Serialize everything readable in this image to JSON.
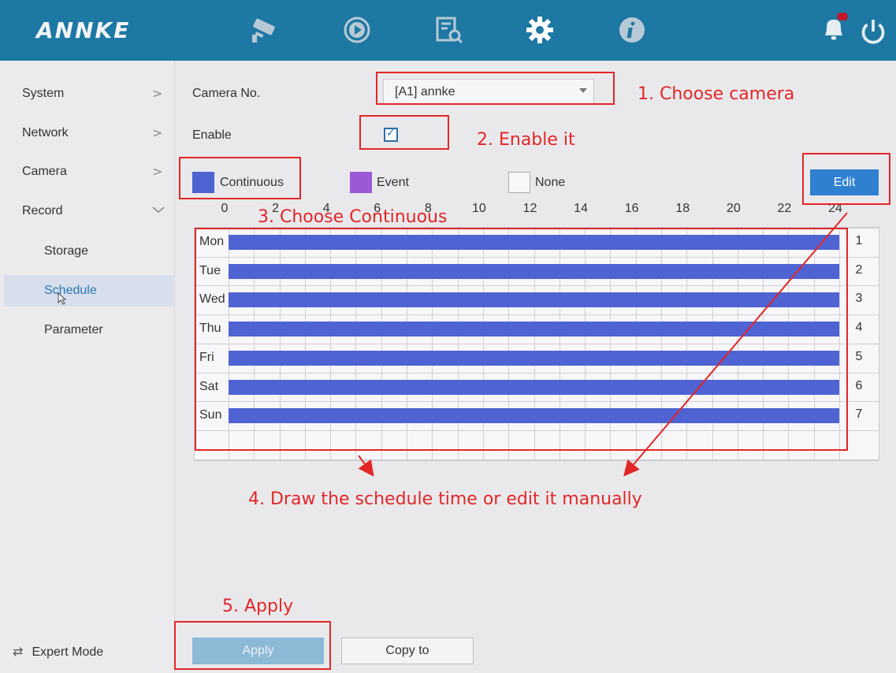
{
  "header": {
    "logo": "ANNKE",
    "nav": [
      {
        "icon": "camera-icon"
      },
      {
        "icon": "playback-icon"
      },
      {
        "icon": "search-file-icon"
      },
      {
        "icon": "gear-icon"
      },
      {
        "icon": "info-icon"
      }
    ],
    "right_icons": [
      "bell-icon",
      "power-icon"
    ]
  },
  "sidebar": {
    "items": [
      {
        "label": "System",
        "icon": "chevron-right-icon"
      },
      {
        "label": "Network",
        "icon": "chevron-right-icon"
      },
      {
        "label": "Camera",
        "icon": "chevron-right-icon"
      },
      {
        "label": "Record",
        "icon": "chevron-down-icon"
      }
    ],
    "subitems": [
      {
        "label": "Storage"
      },
      {
        "label": "Schedule",
        "active": true
      },
      {
        "label": "Parameter"
      }
    ],
    "expert_mode": "Expert Mode"
  },
  "form": {
    "camera_label": "Camera No.",
    "camera_value": "[A1] annke",
    "enable_label": "Enable",
    "enable_checked": true
  },
  "legend": [
    {
      "label": "Continuous",
      "color": "#4f63d2"
    },
    {
      "label": "Event",
      "color": "#9b59d6"
    },
    {
      "label": "None",
      "color": "#f7f7f9"
    }
  ],
  "edit_button": "Edit",
  "schedule": {
    "hour_ticks": [
      "0",
      "2",
      "4",
      "6",
      "8",
      "10",
      "12",
      "14",
      "16",
      "18",
      "20",
      "22",
      "24"
    ],
    "days": [
      "Mon",
      "Tue",
      "Wed",
      "Thu",
      "Fri",
      "Sat",
      "Sun"
    ],
    "row_numbers": [
      "1",
      "2",
      "3",
      "4",
      "5",
      "6",
      "7"
    ],
    "mode": "Continuous",
    "ranges": [
      {
        "day": "Mon",
        "start": 0,
        "end": 24
      },
      {
        "day": "Tue",
        "start": 0,
        "end": 24
      },
      {
        "day": "Wed",
        "start": 0,
        "end": 24
      },
      {
        "day": "Thu",
        "start": 0,
        "end": 24
      },
      {
        "day": "Fri",
        "start": 0,
        "end": 24
      },
      {
        "day": "Sat",
        "start": 0,
        "end": 24
      },
      {
        "day": "Sun",
        "start": 0,
        "end": 24
      }
    ]
  },
  "buttons": {
    "apply": "Apply",
    "copy_to": "Copy to"
  },
  "annotations": {
    "step1": "1. Choose camera",
    "step2": "2. Enable it",
    "step3": "3. Choose Continuous",
    "step4": "4. Draw the schedule time or edit it manually",
    "step5": "5. Apply",
    "color": "#e32626"
  }
}
